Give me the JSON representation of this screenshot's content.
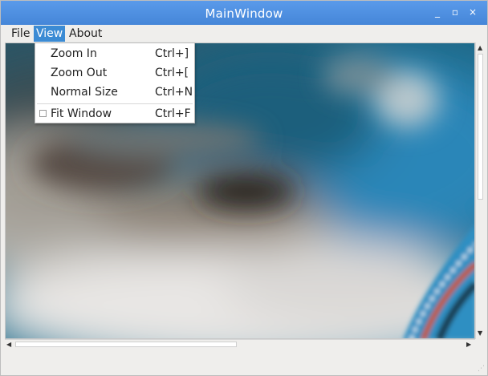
{
  "window": {
    "title": "MainWindow",
    "minimize_glyph": "_",
    "maximize_glyph": "▫",
    "close_glyph": "×"
  },
  "menubar": {
    "items": [
      {
        "label": "File"
      },
      {
        "label": "View"
      },
      {
        "label": "About"
      }
    ],
    "active": "View"
  },
  "view_menu": {
    "items": [
      {
        "label": "Zoom In",
        "shortcut": "Ctrl+]"
      },
      {
        "label": "Zoom Out",
        "shortcut": "Ctrl+["
      },
      {
        "label": "Normal Size",
        "shortcut": "Ctrl+N"
      },
      {
        "label": "Fit Window",
        "shortcut": "Ctrl+F",
        "checkable": true,
        "checked": false
      }
    ]
  },
  "colors": {
    "titlebar": "#4d8fe0",
    "menu_highlight": "#3b8bd4",
    "window_bg": "#efeeec"
  },
  "icons": {
    "minimize": "minimize-icon",
    "maximize": "maximize-icon",
    "close": "close-icon",
    "scroll_up": "arrow-up-icon",
    "scroll_down": "arrow-down-icon",
    "scroll_left": "arrow-left-icon",
    "scroll_right": "arrow-right-icon",
    "size_grip": "size-grip-icon"
  }
}
